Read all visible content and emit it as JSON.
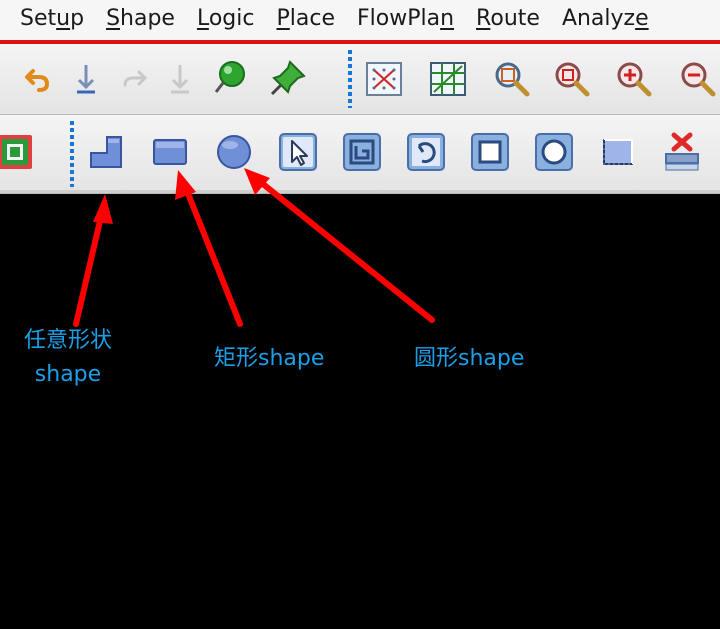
{
  "menu": {
    "items": [
      {
        "pre": "Set",
        "u": "u",
        "post": "p"
      },
      {
        "pre": "",
        "u": "S",
        "post": "hape"
      },
      {
        "pre": "",
        "u": "L",
        "post": "ogic"
      },
      {
        "pre": "",
        "u": "P",
        "post": "lace"
      },
      {
        "pre": "FlowPla",
        "u": "n",
        "post": ""
      },
      {
        "pre": "",
        "u": "R",
        "post": "oute"
      },
      {
        "pre": "Analyz",
        "u": "e",
        "post": ""
      }
    ]
  },
  "toolbar1": {
    "icons": [
      "undo-icon",
      "down-arrow-icon",
      "redo-icon",
      "down-arrow-disabled-icon",
      "green-pin-icon",
      "push-pin-icon",
      "grid-dots-icon",
      "grid-lines-icon",
      "zoom-fit-icon",
      "zoom-area-icon",
      "zoom-in-icon",
      "zoom-out-icon"
    ]
  },
  "toolbar2": {
    "icons": [
      "shape-frame-icon",
      "polygon-shape-icon",
      "rectangle-shape-icon",
      "circle-shape-icon",
      "select-shape-icon",
      "manual-void-icon",
      "circle-void-icon",
      "rectangle-void-icon",
      "circle-rect-void-icon",
      "shape-edit-icon",
      "delete-shape-icon"
    ]
  },
  "annotations": {
    "polygon_line1": "任意形状",
    "polygon_line2": "shape",
    "rectangle": "矩形shape",
    "circle": "圆形shape"
  },
  "colors": {
    "menu_border": "#e01010",
    "arrow": "#ff0000",
    "annotation_text": "#1aa0e8",
    "canvas": "#000000"
  }
}
